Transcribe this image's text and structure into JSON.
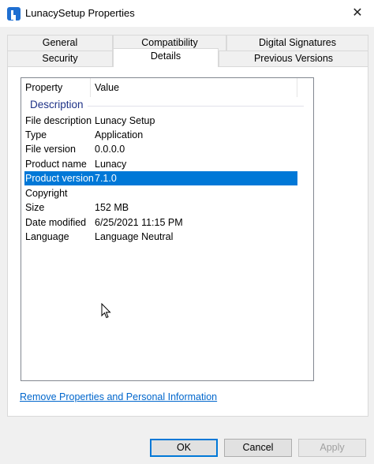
{
  "window": {
    "title": "LunacySetup Properties",
    "close_glyph": "✕"
  },
  "tabs": {
    "row1": [
      "General",
      "Compatibility",
      "Digital Signatures"
    ],
    "row2": [
      "Security",
      "Details",
      "Previous Versions"
    ],
    "active": "Details"
  },
  "details": {
    "columns": {
      "property": "Property",
      "value": "Value"
    },
    "group": "Description",
    "rows": [
      {
        "property": "File description",
        "value": "Lunacy Setup"
      },
      {
        "property": "Type",
        "value": "Application"
      },
      {
        "property": "File version",
        "value": "0.0.0.0"
      },
      {
        "property": "Product name",
        "value": "Lunacy"
      },
      {
        "property": "Product version",
        "value": "7.1.0"
      },
      {
        "property": "Copyright",
        "value": ""
      },
      {
        "property": "Size",
        "value": "152 MB"
      },
      {
        "property": "Date modified",
        "value": "6/25/2021 11:15 PM"
      },
      {
        "property": "Language",
        "value": "Language Neutral"
      }
    ],
    "selected_row": "Product version"
  },
  "link": {
    "remove_properties": "Remove Properties and Personal Information"
  },
  "buttons": {
    "ok": "OK",
    "cancel": "Cancel",
    "apply": "Apply"
  },
  "colors": {
    "selection": "#0078d7",
    "link": "#0066cc",
    "group_heading": "#1e3287"
  }
}
